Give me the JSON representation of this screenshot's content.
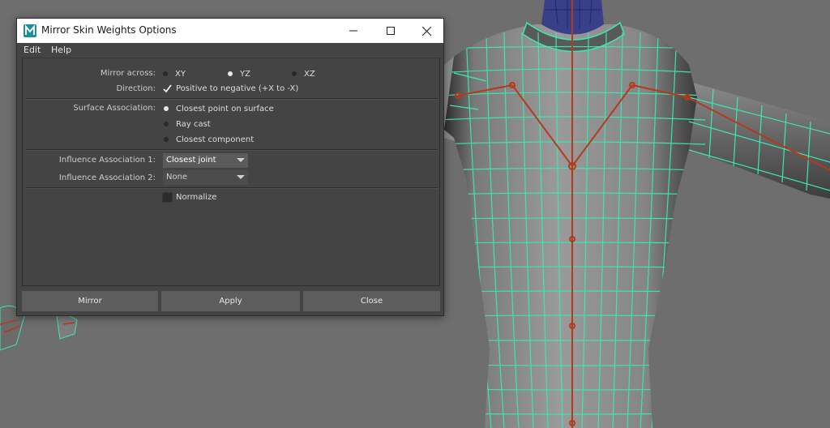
{
  "window": {
    "title": "Mirror Skin Weights Options",
    "minimize_icon": "minimize-icon",
    "maximize_icon": "maximize-icon",
    "close_icon": "close-icon",
    "app_icon": "maya-icon"
  },
  "menu": {
    "items": [
      "Edit",
      "Help"
    ]
  },
  "mirror_across": {
    "label": "Mirror across:",
    "options": [
      "XY",
      "YZ",
      "XZ"
    ],
    "selected": "YZ"
  },
  "direction": {
    "label": "Direction:",
    "checkbox_label": "Positive to negative (+X to -X)",
    "checked": true
  },
  "surface_association": {
    "label": "Surface Association:",
    "options": [
      "Closest point on surface",
      "Ray cast",
      "Closest component"
    ],
    "selected": "Closest point on surface"
  },
  "influence_association_1": {
    "label": "Influence Association 1:",
    "value": "Closest joint"
  },
  "influence_association_2": {
    "label": "Influence Association 2:",
    "value": "None"
  },
  "normalize": {
    "label": "Normalize",
    "checked": false
  },
  "buttons": {
    "mirror": "Mirror",
    "apply": "Apply",
    "close": "Close"
  },
  "colors": {
    "viewport_background": "#6e6e6e",
    "wireframe": "#3de8b0",
    "joint": "#b53a1a",
    "dialog_background": "#444444"
  }
}
